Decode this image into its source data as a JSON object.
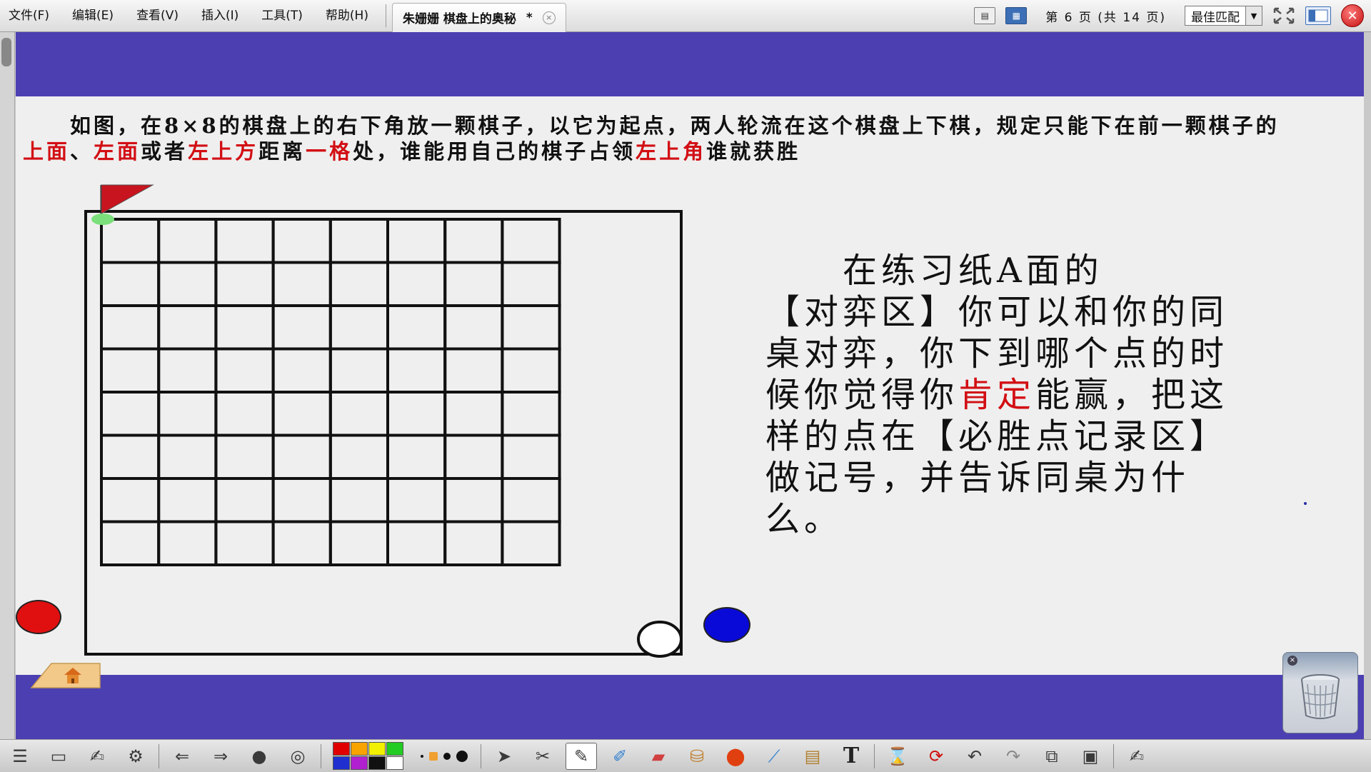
{
  "menu": [
    "文件(F)",
    "编辑(E)",
    "查看(V)",
    "插入(I)",
    "工具(T)",
    "帮助(H)"
  ],
  "tab": {
    "title": "朱姗姗  棋盘上的奥秘",
    "modified": "*",
    "close": "×"
  },
  "page_indicator": "第 6 页 (共 14 页)",
  "zoom": {
    "value": "最佳匹配",
    "arrow": "▼"
  },
  "close_app": "✕",
  "intro": {
    "parts": [
      {
        "text": "　　如图，在8×8的棋盘上的右下角放一颗棋子，以它为起点，两人轮流在这个棋盘上下棋，规定只能下在前一颗棋子的",
        "red": false
      },
      {
        "text": "上面",
        "red": true
      },
      {
        "text": "、",
        "red": false
      },
      {
        "text": "左面",
        "red": true
      },
      {
        "text": "或者",
        "red": false
      },
      {
        "text": "左上方",
        "red": true
      },
      {
        "text": "距离",
        "red": false
      },
      {
        "text": "一格",
        "red": true
      },
      {
        "text": "处，谁能用自己的棋子占领",
        "red": false
      },
      {
        "text": "左上角",
        "red": true
      },
      {
        "text": "谁就获胜",
        "red": false
      }
    ]
  },
  "exercise": {
    "line1": "　　在练习纸A面的",
    "line2a": "【对弈区】你可以和你的同桌对弈，你下到哪个点的时候你觉得你",
    "red": "肯定",
    "line2b": "能赢，把这样的点在【必胜点记录区】做记号，并告诉同桌为什么。"
  },
  "board": {
    "rows": 8,
    "cols": 8
  },
  "colors": {
    "band": "#4b3fb2",
    "accent_red": "#d20f14",
    "red_piece": "#e01010",
    "blue_piece": "#0a0ad8",
    "flag": "#c8141e",
    "flag_base": "#7be07b"
  },
  "toolbar": {
    "icons": [
      "slide-list-icon",
      "presentation-icon",
      "whiteboard-icon",
      "settings-icon",
      "previous-page-icon",
      "next-page-icon",
      "play-icon",
      "browser-icon",
      "color-palette",
      "pen-size-picker",
      "select-arrow-icon",
      "tools-icon",
      "pen-icon",
      "highlighter-icon",
      "eraser-icon",
      "fill-icon",
      "shape-icon",
      "line-icon",
      "clear-icon",
      "text-icon",
      "hourglass-icon",
      "refresh-icon",
      "undo-icon",
      "redo-icon",
      "screen-capture-icon",
      "window-icon",
      "signature-icon"
    ],
    "palette": [
      "#e00000",
      "#f7a300",
      "#f0f000",
      "#22cc22",
      "#2030d0",
      "#b020d0",
      "#111111",
      "#ffffff"
    ],
    "text_tool": "T"
  },
  "trash": {
    "close": "×"
  }
}
